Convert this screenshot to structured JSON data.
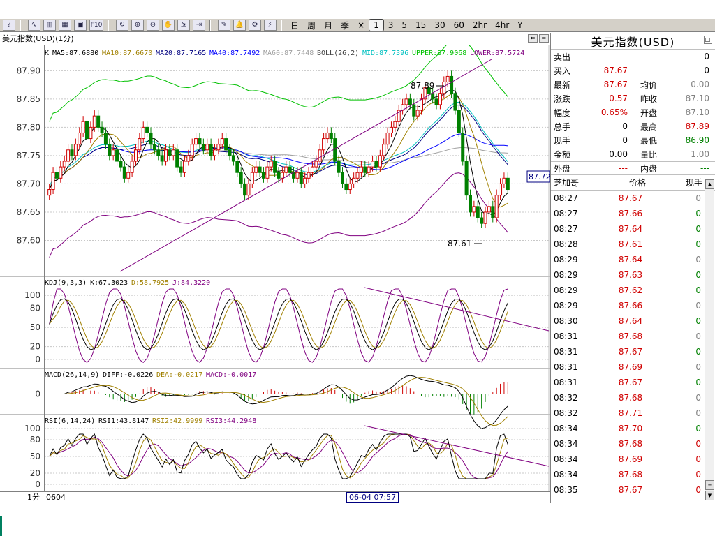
{
  "toolbar": {
    "icons": [
      "help-icon",
      "line-chart-icon",
      "bar-chart-icon",
      "table-icon",
      "window-icon",
      "f10-icon",
      "refresh-icon",
      "zoom-in-icon",
      "zoom-out-icon",
      "hand-icon",
      "export-icon",
      "import-icon",
      "draw-icon",
      "alert-icon",
      "settings-icon",
      "flash-icon"
    ],
    "f10_label": "F10",
    "periods": [
      "日",
      "周",
      "月",
      "季",
      "×",
      "1",
      "3",
      "5",
      "15",
      "30",
      "60",
      "2hr",
      "4hr",
      "Y"
    ],
    "active_period": "1"
  },
  "chart": {
    "header_title": "美元指数(USD)(1分)",
    "main_legend": {
      "k": "K",
      "ma5": "MA5:87.6880",
      "ma10": "MA10:87.6670",
      "ma20": "MA20:87.7165",
      "ma40": "MA40:87.7492",
      "ma60": "MA60:87.7448",
      "boll": "BOLL(26,2)",
      "mid": "MID:87.7396",
      "upper": "UPPER:87.9068",
      "lower": "LOWER:87.5724"
    },
    "kdj_legend": {
      "name": "KDJ(9,3,3)",
      "k": "K:67.3023",
      "d": "D:58.7925",
      "j": "J:84.3220"
    },
    "macd_legend": {
      "name": "MACD(26,14,9)",
      "diff": "DIFF:-0.0226",
      "dea": "DEA:-0.0217",
      "macd": "MACD:-0.0017"
    },
    "rsi_legend": {
      "name": "RSI(6,14,24)",
      "rsi1": "RSI1:43.8147",
      "rsi2": "RSI2:42.9999",
      "rsi3": "RSI3:44.2948"
    },
    "price_axis": [
      "87.90",
      "87.85",
      "87.80",
      "87.75",
      "87.70",
      "87.65",
      "87.60"
    ],
    "kdj_axis": [
      "100",
      "80",
      "50",
      "20",
      "0"
    ],
    "macd_axis": [
      "0"
    ],
    "rsi_axis": [
      "100",
      "80",
      "50",
      "20",
      "0"
    ],
    "annotations": {
      "high": "87.89",
      "low": "87.61",
      "last_price": "87.72"
    },
    "colors": {
      "up": "#d00000",
      "down": "#008000",
      "ma5": "#000000",
      "ma10": "#a08000",
      "ma20": "#000080",
      "ma40": "#0000ff",
      "ma60": "#a0a0a0",
      "mid": "#00c0c0",
      "upper": "#00c000",
      "lower": "#800080"
    }
  },
  "chart_data": {
    "type": "candlestick",
    "ylim": [
      87.55,
      87.93
    ],
    "closes": [
      87.69,
      87.72,
      87.71,
      87.73,
      87.74,
      87.76,
      87.75,
      87.77,
      87.79,
      87.81,
      87.78,
      87.8,
      87.82,
      87.8,
      87.79,
      87.77,
      87.75,
      87.76,
      87.74,
      87.73,
      87.71,
      87.72,
      87.74,
      87.76,
      87.78,
      87.8,
      87.79,
      87.77,
      87.76,
      87.75,
      87.74,
      87.76,
      87.75,
      87.76,
      87.73,
      87.72,
      87.74,
      87.75,
      87.77,
      87.78,
      87.77,
      87.76,
      87.77,
      87.75,
      87.76,
      87.77,
      87.78,
      87.76,
      87.75,
      87.74,
      87.72,
      87.7,
      87.68,
      87.7,
      87.72,
      87.73,
      87.72,
      87.71,
      87.73,
      87.74,
      87.72,
      87.71,
      87.72,
      87.73,
      87.72,
      87.71,
      87.72,
      87.7,
      87.71,
      87.72,
      87.73,
      87.74,
      87.76,
      87.78,
      87.79,
      87.78,
      87.74,
      87.72,
      87.7,
      87.69,
      87.7,
      87.71,
      87.72,
      87.73,
      87.72,
      87.73,
      87.74,
      87.73,
      87.75,
      87.77,
      87.79,
      87.8,
      87.81,
      87.83,
      87.84,
      87.85,
      87.84,
      87.82,
      87.83,
      87.85,
      87.87,
      87.86,
      87.85,
      87.84,
      87.86,
      87.88,
      87.89,
      87.86,
      87.83,
      87.79,
      87.74,
      87.68,
      87.65,
      87.66,
      87.64,
      87.63,
      87.65,
      87.66,
      87.64,
      87.68,
      87.7,
      87.71,
      87.69
    ],
    "ma5_last": 87.688,
    "ma10_last": 87.667,
    "mid_last": 87.7396,
    "upper_last": 87.9068,
    "lower_last": 87.5724,
    "kdj": {
      "k_last": 67.3023,
      "d_last": 58.7925,
      "j_last": 84.322
    },
    "macd": {
      "diff_last": -0.0226,
      "dea_last": -0.0217,
      "macd_last": -0.0017
    },
    "rsi": {
      "rsi1_last": 43.8147,
      "rsi2_last": 42.9999,
      "rsi3_last": 44.2948
    },
    "xlabel": "",
    "ylabel": ""
  },
  "quote": {
    "title": "美元指数(USD)",
    "rows": [
      {
        "l1": "卖出",
        "v1": "---",
        "l2": "",
        "v2": "0",
        "c1": "gray",
        "c2": ""
      },
      {
        "l1": "买入",
        "v1": "87.67",
        "l2": "",
        "v2": "0",
        "c1": "red",
        "c2": ""
      },
      {
        "l1": "最新",
        "v1": "87.67",
        "l2": "均价",
        "v2": "0.00",
        "c1": "red",
        "c2": "gray"
      },
      {
        "l1": "涨跌",
        "v1": "0.57",
        "l2": "昨收",
        "v2": "87.10",
        "c1": "red",
        "c2": "gray"
      },
      {
        "l1": "幅度",
        "v1": "0.65%",
        "l2": "开盘",
        "v2": "87.10",
        "c1": "red",
        "c2": "gray"
      },
      {
        "l1": "总手",
        "v1": "0",
        "l2": "最高",
        "v2": "87.89",
        "c1": "",
        "c2": "red"
      },
      {
        "l1": "现手",
        "v1": "0",
        "l2": "最低",
        "v2": "86.90",
        "c1": "",
        "c2": "green"
      },
      {
        "l1": "金额",
        "v1": "0.00",
        "l2": "量比",
        "v2": "1.00",
        "c1": "",
        "c2": "gray"
      }
    ],
    "outer_label": "外盘",
    "outer_value": "---",
    "inner_label": "内盘",
    "inner_value": "---"
  },
  "ticks": {
    "headers": [
      "芝加哥",
      "价格",
      "现手"
    ],
    "items": [
      {
        "time": "08:27",
        "price": "87.67",
        "vol": "0",
        "vc": "gray"
      },
      {
        "time": "08:27",
        "price": "87.66",
        "vol": "0",
        "vc": "green"
      },
      {
        "time": "08:27",
        "price": "87.64",
        "vol": "0",
        "vc": "green"
      },
      {
        "time": "08:28",
        "price": "87.61",
        "vol": "0",
        "vc": "green"
      },
      {
        "time": "08:29",
        "price": "87.64",
        "vol": "0",
        "vc": "gray"
      },
      {
        "time": "08:29",
        "price": "87.63",
        "vol": "0",
        "vc": "green"
      },
      {
        "time": "08:29",
        "price": "87.62",
        "vol": "0",
        "vc": "green"
      },
      {
        "time": "08:29",
        "price": "87.66",
        "vol": "0",
        "vc": "gray"
      },
      {
        "time": "08:30",
        "price": "87.64",
        "vol": "0",
        "vc": "green"
      },
      {
        "time": "08:31",
        "price": "87.68",
        "vol": "0",
        "vc": "gray"
      },
      {
        "time": "08:31",
        "price": "87.67",
        "vol": "0",
        "vc": "green"
      },
      {
        "time": "08:31",
        "price": "87.69",
        "vol": "0",
        "vc": "gray"
      },
      {
        "time": "08:31",
        "price": "87.67",
        "vol": "0",
        "vc": "green"
      },
      {
        "time": "08:32",
        "price": "87.68",
        "vol": "0",
        "vc": "gray"
      },
      {
        "time": "08:32",
        "price": "87.71",
        "vol": "0",
        "vc": "gray"
      },
      {
        "time": "08:34",
        "price": "87.70",
        "vol": "0",
        "vc": "green"
      },
      {
        "time": "08:34",
        "price": "87.68",
        "vol": "0",
        "vc": "red"
      },
      {
        "time": "08:34",
        "price": "87.69",
        "vol": "0",
        "vc": "red"
      },
      {
        "time": "08:34",
        "price": "87.68",
        "vol": "0",
        "vc": "red"
      },
      {
        "time": "08:35",
        "price": "87.67",
        "vol": "0",
        "vc": "red"
      }
    ]
  },
  "status": {
    "period": "1分",
    "date": "0604",
    "cursor": "06-04 07:57"
  }
}
